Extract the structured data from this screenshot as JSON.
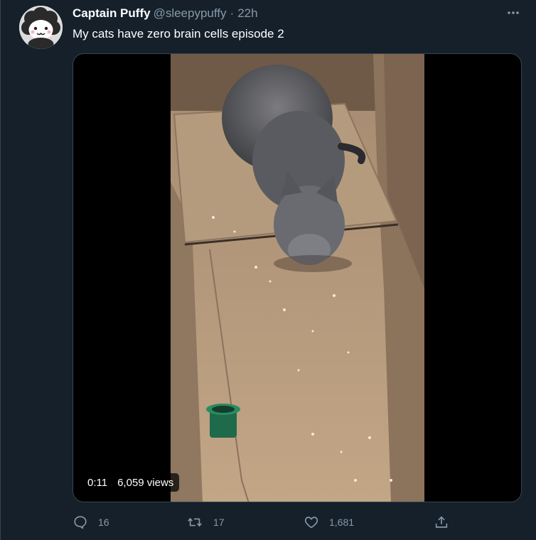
{
  "tweet": {
    "display_name": "Captain Puffy",
    "handle": "@sleepypuffy",
    "separator": "·",
    "time": "22h",
    "text": "My cats have zero brain cells episode 2"
  },
  "media": {
    "type": "video",
    "duration": "0:11",
    "views": "6,059 views"
  },
  "actions": {
    "reply_count": "16",
    "retweet_count": "17",
    "like_count": "1,681"
  },
  "icons": {
    "more": "more-horizontal-icon",
    "reply": "reply-icon",
    "retweet": "retweet-icon",
    "like": "heart-icon",
    "share": "share-icon"
  },
  "colors": {
    "background": "#15202b",
    "text_primary": "#ffffff",
    "text_secondary": "#8899a6",
    "border": "#38444d"
  }
}
